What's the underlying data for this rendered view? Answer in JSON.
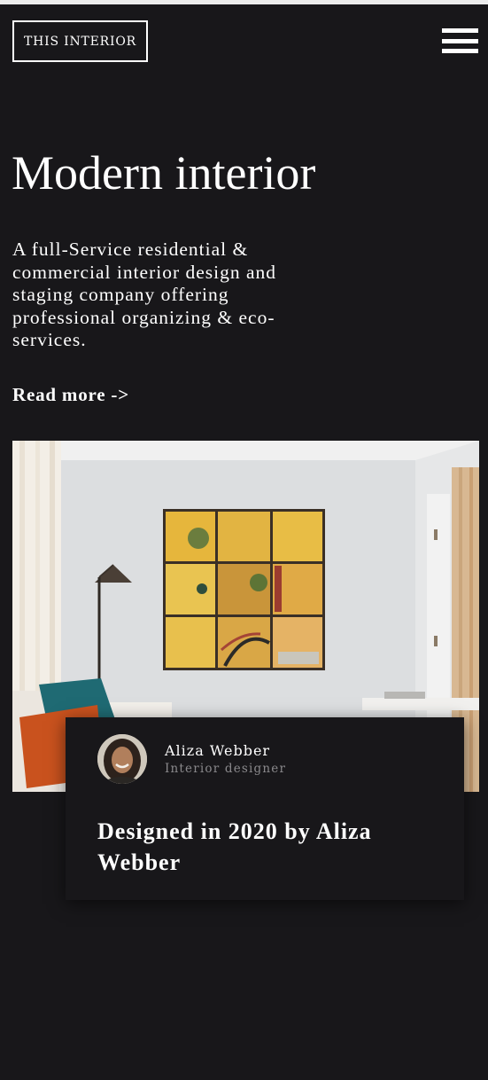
{
  "header": {
    "logo_text": "THIS INTERIOR",
    "menu_icon": "hamburger-menu-icon"
  },
  "hero": {
    "title": "Modern interior",
    "description": "A full-Service residential & commercial interior design and staging company offering professional organizing & eco-services.",
    "read_more": "Read more ->"
  },
  "feature": {
    "image_subject": "living-room-photo",
    "author": {
      "name": "Aliza Webber",
      "role": "Interior designer"
    },
    "heading": "Designed in 2020 by Aliza Webber"
  },
  "colors": {
    "background": "#18171a",
    "text": "#ffffff",
    "muted_text": "#8a898c",
    "top_strip": "#ececec"
  }
}
